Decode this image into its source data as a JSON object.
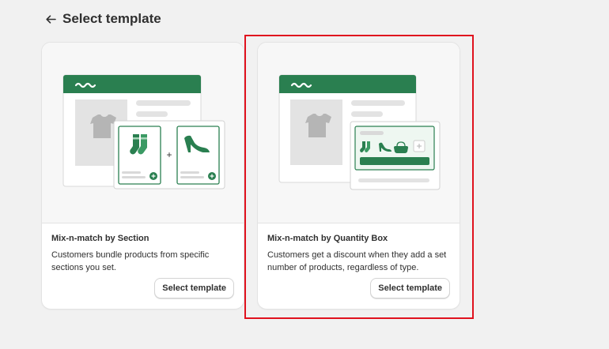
{
  "page": {
    "title": "Select template"
  },
  "colors": {
    "brand_green": "#2a7f50",
    "highlight_red": "#e0121e"
  },
  "templates": [
    {
      "title": "Mix-n-match by Section",
      "description": "Customers bundle products from specific sections you set.",
      "button_label": "Select template",
      "illustration": "section-bundle-illustration"
    },
    {
      "title": "Mix-n-match by Quantity Box",
      "description": "Customers get a discount when they add a set number of products, regardless of type.",
      "button_label": "Select template",
      "illustration": "quantity-box-illustration",
      "highlighted": true
    }
  ]
}
